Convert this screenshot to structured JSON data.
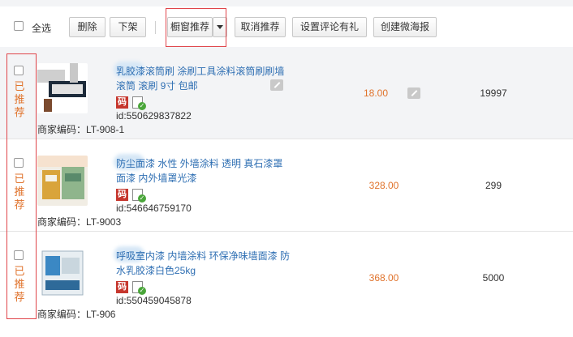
{
  "toolbar": {
    "select_all": "全选",
    "delete": "删除",
    "take_down": "下架",
    "window_recommend": "橱窗推荐",
    "cancel_recommend": "取消推荐",
    "review_gift": "设置评论有礼",
    "create_poster": "创建微海报"
  },
  "products": [
    {
      "status": "已推荐",
      "title": "乳胶漆滚筒刷 涂刷工具涂料滚筒刷刷墙滚筒 滚刷 9寸 包邮",
      "badge": "码",
      "id": "id:550629837822",
      "merchant_code": "商家编码：LT-908-1",
      "price": "18.00",
      "stock": "19997"
    },
    {
      "status": "已推荐",
      "title": "防尘面漆 水性 外墙涂料 透明 真石漆罩面漆 内外墙罩光漆",
      "badge": "码",
      "id": "id:546646759170",
      "merchant_code": "商家编码：LT-9003",
      "price": "328.00",
      "stock": "299"
    },
    {
      "status": "已推荐",
      "title": "呼吸室内漆 内墙涂料 环保净味墙面漆 防水乳胶漆白色25kg",
      "badge": "码",
      "id": "id:550459045878",
      "merchant_code": "商家编码：LT-906",
      "price": "368.00",
      "stock": "5000"
    }
  ],
  "colors": {
    "link": "#2f6fb3",
    "price": "#e0732c",
    "highlight": "#e0454a",
    "badge": "#c6372e"
  },
  "icons": [
    "checkbox-icon",
    "caret-down-icon",
    "edit-icon",
    "code-badge-icon",
    "document-verified-icon"
  ]
}
